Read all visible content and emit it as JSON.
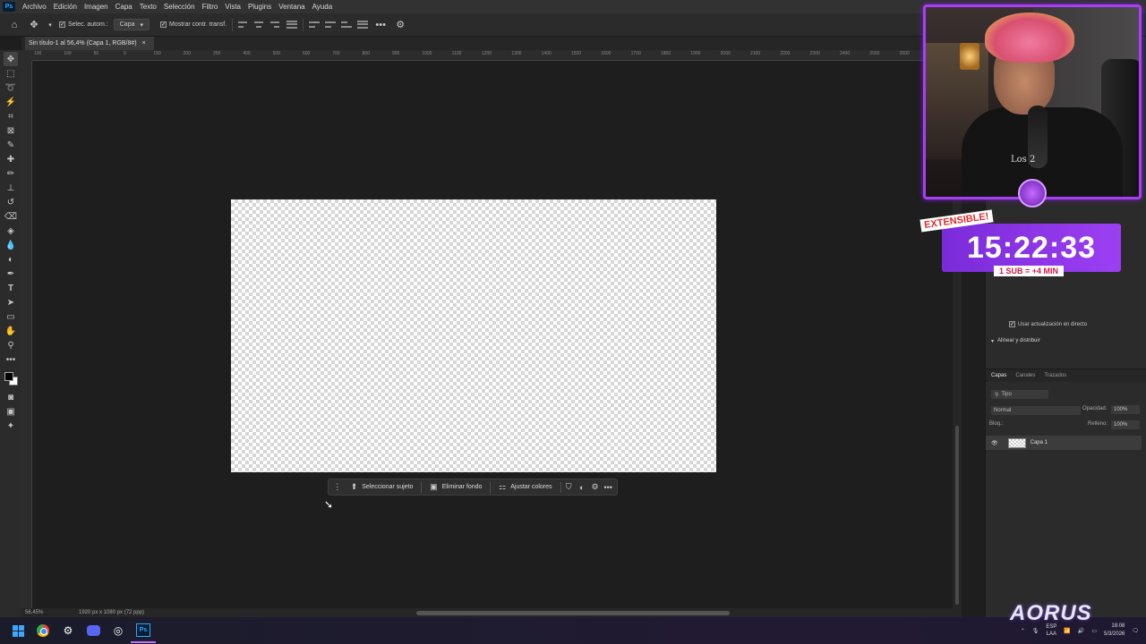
{
  "app": {
    "logo": "Ps"
  },
  "menu": [
    "Archivo",
    "Edición",
    "Imagen",
    "Capa",
    "Texto",
    "Selección",
    "Filtro",
    "Vista",
    "Plugins",
    "Ventana",
    "Ayuda"
  ],
  "options": {
    "auto_select_label": "Selec. autom.:",
    "auto_select_value": "Capa",
    "show_transform_label": "Mostrar contr. transf."
  },
  "document": {
    "tab_title": "Sin título-1 al 56,4% (Capa 1, RGB/8#)",
    "close_glyph": "×"
  },
  "ruler_ticks": [
    "100",
    "100",
    "50",
    "0",
    "150",
    "200",
    "250",
    "400",
    "500",
    "600",
    "700",
    "800",
    "900",
    "1000",
    "1100",
    "1200",
    "1300",
    "1400",
    "1500",
    "1600",
    "1700",
    "1800",
    "1900",
    "2000",
    "2100",
    "2200",
    "2300",
    "2400",
    "2500",
    "2600"
  ],
  "contextual_bar": {
    "select_subject": "Seleccionar sujeto",
    "remove_background": "Eliminar fondo",
    "adjust_colors": "Ajustar colores"
  },
  "status": {
    "zoom": "56,45%",
    "doc_size": "1920 px x 1080 px (72 ppp)"
  },
  "properties": {
    "live_update": "Usar actualización en directo",
    "align_distribute": "Alinear y distribuir"
  },
  "layers": {
    "tabs": [
      "Capas",
      "Canales",
      "Trazados"
    ],
    "filter": "Tipo",
    "blend_mode": "Normal",
    "opacity_label": "Opacidad:",
    "opacity_value": "100%",
    "lock_label": "Bloq.:",
    "fill_label": "Relleno:",
    "fill_value": "100%",
    "layer_name": "Capa 1"
  },
  "stream_overlay": {
    "shirt_text": "Los 2",
    "extensible": "EXTENSIBLE!",
    "timer": "15:22:33",
    "sub_rule": "1 SUB = +4 MIN",
    "brand": "AORUS"
  },
  "tray": {
    "lang_top": "ESP",
    "lang_bottom": "LAA",
    "time": "18:08",
    "date": "5/3/2026"
  },
  "colors": {
    "accent_purple": "#9c3ff2",
    "timer_red": "#e52b2b",
    "ps_blue": "#31a8ff"
  }
}
